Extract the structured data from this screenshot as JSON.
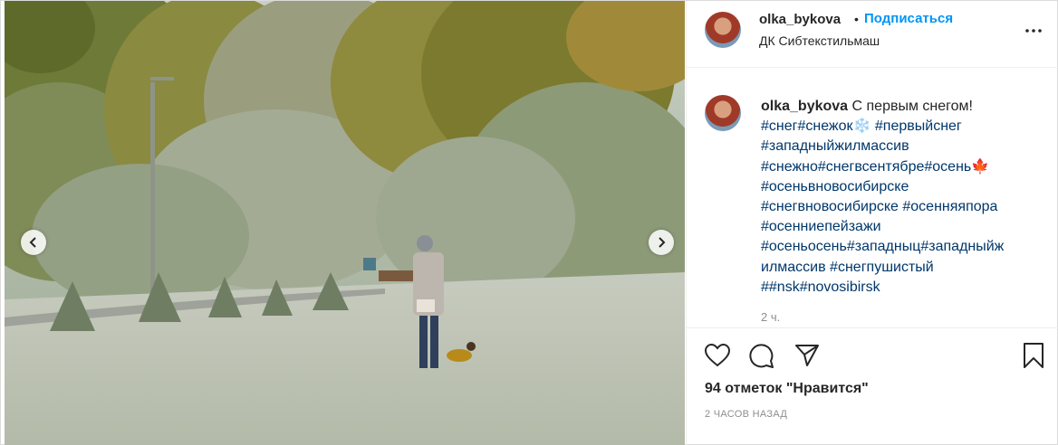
{
  "header": {
    "username": "olka_bykova",
    "dot": "•",
    "follow_label": "Подписаться",
    "location": "ДК Сибтекстильмаш"
  },
  "caption": {
    "username": "olka_bykova",
    "text": "С первым снегом!",
    "tag_lines": [
      "#снег#снежок❄️ #первыйснег",
      "#западныйжилмассив",
      "#снежно#снегвсентябре#осень🍁",
      "#осеньвновосибирске",
      "#снегвновосибирске #осенняяпора",
      "#осенниепейзажи",
      "#осеньосень#западныц#западныйж",
      "илмассив #снегпушистый",
      "##nsk#novosibirsk"
    ],
    "time": "2 ч."
  },
  "actions": {
    "likes": "94 отметок \"Нравится\"",
    "posted_ago": "2 ЧАСОВ НАЗАД"
  },
  "icons": [
    "chevron-left-icon",
    "chevron-right-icon",
    "more-icon",
    "heart-icon",
    "comment-icon",
    "share-icon",
    "bookmark-icon"
  ],
  "colors": {
    "link": "#0095f6",
    "hashtag": "#00376b",
    "muted": "#8e8e8e"
  }
}
